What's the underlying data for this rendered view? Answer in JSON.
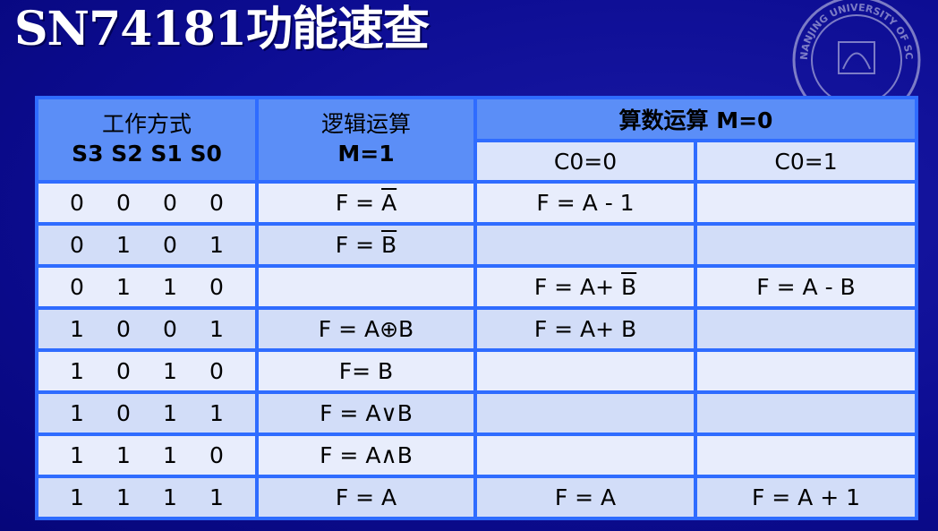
{
  "title": "SN74181功能速查",
  "header": {
    "mode_label": "工作方式",
    "select_labels": "S3  S2  S1  S0",
    "logic_label": "逻辑运算",
    "logic_mode": "M=1",
    "arith_label": "算数运算 M=0",
    "c0_0": "C0=0",
    "c0_1": "C0=1"
  },
  "rows": [
    {
      "s3": "0",
      "s2": "0",
      "s1": "0",
      "s0": "0",
      "logic_pre": "F = ",
      "logic_ov": "A",
      "arith0_pre": "F = A - 1",
      "arith0_ov": "",
      "arith1": ""
    },
    {
      "s3": "0",
      "s2": "1",
      "s1": "0",
      "s0": "1",
      "logic_pre": "F = ",
      "logic_ov": "B",
      "arith0_pre": "",
      "arith0_ov": "",
      "arith1": ""
    },
    {
      "s3": "0",
      "s2": "1",
      "s1": "1",
      "s0": "0",
      "logic_pre": "",
      "logic_ov": "",
      "arith0_pre": "F = A+ ",
      "arith0_ov": "B",
      "arith1": "F = A - B"
    },
    {
      "s3": "1",
      "s2": "0",
      "s1": "0",
      "s0": "1",
      "logic_pre": "F = A⊕B",
      "logic_ov": "",
      "arith0_pre": "F = A+ B",
      "arith0_ov": "",
      "arith1": ""
    },
    {
      "s3": "1",
      "s2": "0",
      "s1": "1",
      "s0": "0",
      "logic_pre": "F= B",
      "logic_ov": "",
      "arith0_pre": "",
      "arith0_ov": "",
      "arith1": ""
    },
    {
      "s3": "1",
      "s2": "0",
      "s1": "1",
      "s0": "1",
      "logic_pre": "F = A∨B",
      "logic_ov": "",
      "arith0_pre": "",
      "arith0_ov": "",
      "arith1": ""
    },
    {
      "s3": "1",
      "s2": "1",
      "s1": "1",
      "s0": "0",
      "logic_pre": "F = A∧B",
      "logic_ov": "",
      "arith0_pre": "",
      "arith0_ov": "",
      "arith1": ""
    },
    {
      "s3": "1",
      "s2": "1",
      "s1": "1",
      "s0": "1",
      "logic_pre": "F = A",
      "logic_ov": "",
      "arith0_pre": "F = A",
      "arith0_ov": "",
      "arith1": "F = A + 1"
    }
  ],
  "seal_text": "NANJING UNIVERSITY OF SCIENCE",
  "colors": {
    "background": "#0d0d93",
    "header": "#5b8ef7",
    "border": "#2f6cff",
    "row_light": "#e8edfc",
    "row_dark": "#d2ddf8"
  }
}
